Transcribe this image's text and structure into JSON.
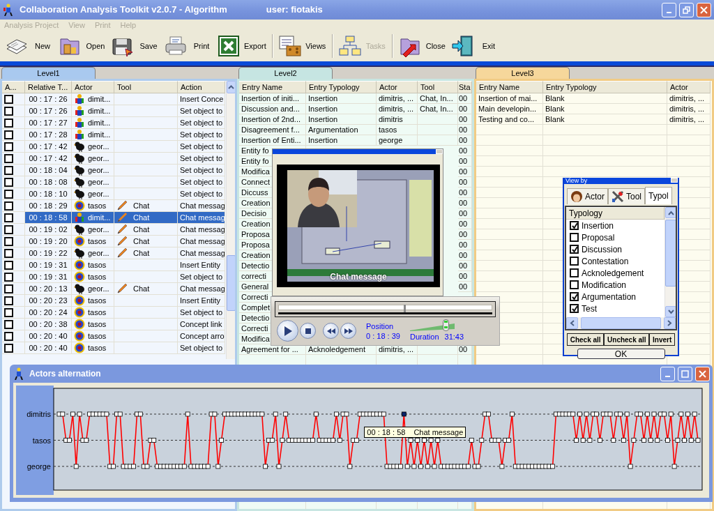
{
  "window": {
    "title": "Collaboration Analysis Toolkit v2.0.7 - Algorithm",
    "user": "user: fiotakis"
  },
  "menu": [
    {
      "label": "Analysis Project",
      "disabled": true
    },
    {
      "label": "View",
      "disabled": true
    },
    {
      "label": "Print",
      "disabled": true
    },
    {
      "label": "Help",
      "disabled": true
    }
  ],
  "toolbar": [
    {
      "label": "New",
      "kind": "new",
      "disabled": false
    },
    {
      "label": "Open",
      "kind": "open",
      "disabled": false
    },
    {
      "label": "Save",
      "kind": "save",
      "disabled": false
    },
    {
      "label": "Print",
      "kind": "print",
      "disabled": false
    },
    {
      "label": "Export",
      "kind": "export",
      "disabled": false
    },
    {
      "label": "Views",
      "kind": "views",
      "disabled": false,
      "separator_before": true
    },
    {
      "label": "Tasks",
      "kind": "tasks",
      "disabled": true,
      "separator_before": true
    },
    {
      "label": "Close",
      "kind": "close",
      "disabled": false,
      "separator_before": true
    },
    {
      "label": "Exit",
      "kind": "exit",
      "disabled": false
    }
  ],
  "panels": [
    {
      "tab": "Level1",
      "kind": "events",
      "columns": [
        "A...",
        "Relative T...",
        "Actor",
        "Tool",
        "Action"
      ],
      "rows": [
        {
          "checked": false,
          "selected": false,
          "time": "00 : 17 : 26",
          "actor": "dimit...",
          "kind": "figure",
          "action": "Insert Conce"
        },
        {
          "checked": false,
          "selected": false,
          "time": "00 : 17 : 26",
          "actor": "dimit...",
          "kind": "figure",
          "action": "Set object to"
        },
        {
          "checked": false,
          "selected": false,
          "time": "00 : 17 : 27",
          "actor": "dimit...",
          "kind": "figure",
          "action": "Set object to"
        },
        {
          "checked": false,
          "selected": false,
          "time": "00 : 17 : 28",
          "actor": "dimit...",
          "kind": "figure",
          "action": "Set object to"
        },
        {
          "checked": false,
          "selected": false,
          "time": "00 : 17 : 42",
          "actor": "geor...",
          "kind": "bird",
          "action": "Set object to"
        },
        {
          "checked": false,
          "selected": false,
          "time": "00 : 17 : 42",
          "actor": "geor...",
          "kind": "bird",
          "action": "Set object to"
        },
        {
          "checked": false,
          "selected": false,
          "time": "00 : 18 : 04",
          "actor": "geor...",
          "kind": "bird",
          "action": "Set object to"
        },
        {
          "checked": false,
          "selected": false,
          "time": "00 : 18 : 08",
          "actor": "geor...",
          "kind": "bird",
          "action": "Set object to"
        },
        {
          "checked": false,
          "selected": false,
          "time": "00 : 18 : 10",
          "actor": "geor...",
          "kind": "bird",
          "action": "Set object to"
        },
        {
          "checked": false,
          "selected": false,
          "time": "00 : 18 : 29",
          "actor": "tasos",
          "kind": "globe",
          "tool": "Chat",
          "action": "Chat messag"
        },
        {
          "checked": false,
          "selected": true,
          "time": "00 : 18 : 58",
          "actor": "dimit...",
          "kind": "figure",
          "tool": "Chat",
          "action": "Chat messag"
        },
        {
          "checked": false,
          "selected": false,
          "time": "00 : 19 : 02",
          "actor": "geor...",
          "kind": "bird",
          "tool": "Chat",
          "action": "Chat messag"
        },
        {
          "checked": false,
          "selected": false,
          "time": "00 : 19 : 20",
          "actor": "tasos",
          "kind": "globe",
          "tool": "Chat",
          "action": "Chat messag"
        },
        {
          "checked": false,
          "selected": false,
          "time": "00 : 19 : 22",
          "actor": "geor...",
          "kind": "bird",
          "tool": "Chat",
          "action": "Chat messag"
        },
        {
          "checked": false,
          "selected": false,
          "time": "00 : 19 : 31",
          "actor": "tasos",
          "kind": "globe",
          "action": "Insert Entity"
        },
        {
          "checked": false,
          "selected": false,
          "time": "00 : 19 : 31",
          "actor": "tasos",
          "kind": "globe",
          "action": "Set object to"
        },
        {
          "checked": false,
          "selected": false,
          "time": "00 : 20 : 13",
          "actor": "geor...",
          "kind": "bird",
          "tool": "Chat",
          "action": "Chat messag"
        },
        {
          "checked": false,
          "selected": false,
          "time": "00 : 20 : 23",
          "actor": "tasos",
          "kind": "globe",
          "action": "Insert Entity"
        },
        {
          "checked": false,
          "selected": false,
          "time": "00 : 20 : 24",
          "actor": "tasos",
          "kind": "globe",
          "action": "Set object to"
        },
        {
          "checked": false,
          "selected": false,
          "time": "00 : 20 : 38",
          "actor": "tasos",
          "kind": "globe",
          "action": "Concept link"
        },
        {
          "checked": false,
          "selected": false,
          "time": "00 : 20 : 40",
          "actor": "tasos",
          "kind": "globe",
          "action": "Concept arro"
        },
        {
          "checked": false,
          "selected": false,
          "time": "00 : 20 : 40",
          "actor": "tasos",
          "kind": "globe",
          "action": "Set object to"
        }
      ]
    },
    {
      "tab": "Level2",
      "kind": "entries",
      "columns": [
        "Entry Name",
        "Entry Typology",
        "Actor",
        "Tool",
        "Sta"
      ],
      "rows": [
        {
          "cells": [
            "Insertion of initi...",
            "Insertion",
            "dimitris, ...",
            "Chat, In...",
            "00"
          ]
        },
        {
          "cells": [
            "Discussion and...",
            "Insertion",
            "dimitris, ...",
            "Chat, In...",
            "00"
          ]
        },
        {
          "cells": [
            "Insertion of 2nd...",
            "Insertion",
            "dimitris",
            null,
            "00"
          ]
        },
        {
          "cells": [
            "Disagreement f...",
            "Argumentation",
            "tasos",
            null,
            "00"
          ]
        },
        {
          "cells": [
            "Insertion of Enti...",
            "Insertion",
            "george",
            null,
            "00"
          ]
        },
        {
          "cells": [
            "Entity fo",
            null,
            null,
            null,
            "00"
          ]
        },
        {
          "cells": [
            "Entity fo",
            null,
            null,
            null,
            "00"
          ]
        },
        {
          "cells": [
            "Modifica",
            null,
            null,
            null,
            "00"
          ]
        },
        {
          "cells": [
            "Connect",
            null,
            null,
            null,
            "00"
          ]
        },
        {
          "cells": [
            "Diccuss",
            null,
            null,
            null,
            "00"
          ]
        },
        {
          "cells": [
            "Creation",
            null,
            null,
            null,
            "00"
          ]
        },
        {
          "cells": [
            "Decisio",
            null,
            null,
            null,
            "00"
          ]
        },
        {
          "cells": [
            "Creation",
            null,
            null,
            null,
            "00"
          ]
        },
        {
          "cells": [
            "Proposa",
            null,
            null,
            null,
            "00"
          ]
        },
        {
          "cells": [
            "Proposa",
            null,
            null,
            null,
            "00"
          ]
        },
        {
          "cells": [
            "Creation",
            null,
            null,
            null,
            "00"
          ]
        },
        {
          "cells": [
            "Detectio",
            null,
            null,
            null,
            "00"
          ]
        },
        {
          "cells": [
            "correcti",
            null,
            null,
            null,
            "00"
          ]
        },
        {
          "cells": [
            "General",
            null,
            null,
            null,
            "00"
          ]
        },
        {
          "cells": [
            "Correcti",
            null,
            null,
            null,
            null
          ]
        },
        {
          "cells": [
            "Complet",
            null,
            null,
            null,
            null
          ]
        },
        {
          "cells": [
            "Detectio",
            null,
            null,
            null,
            null
          ]
        },
        {
          "cells": [
            "Correcti",
            null,
            null,
            null,
            null
          ]
        },
        {
          "cells": [
            "Modifica",
            null,
            null,
            null,
            null
          ]
        },
        {
          "cells": [
            "Agreement for ...",
            "Acknoledgement",
            "dimitris, ...",
            null,
            "00"
          ]
        }
      ]
    },
    {
      "tab": "Level3",
      "kind": "entries",
      "columns": [
        "Entry Name",
        "Entry Typology",
        "Actor"
      ],
      "rows": [
        {
          "cells": [
            "Insertion of mai...",
            "Blank",
            "dimitris, ..."
          ]
        },
        {
          "cells": [
            "Main developin...",
            "Blank",
            "dimitris, ..."
          ]
        },
        {
          "cells": [
            "Testing and co...",
            "Blank",
            "dimitris, ..."
          ]
        }
      ]
    }
  ],
  "video": {
    "caption": "Chat message",
    "seek": {
      "level": 0.59
    },
    "position_label": "Position",
    "position": "0 : 18 : 39",
    "volume": {
      "level": 0.8
    },
    "duration_label": "Duration",
    "duration": "31:43"
  },
  "view_by": {
    "title": "View by",
    "tabs": [
      {
        "label": "Actor",
        "kind": "actor",
        "selected": false
      },
      {
        "label": "Tool",
        "kind": "tool",
        "selected": false
      },
      {
        "label": "Typol",
        "selected": true
      }
    ],
    "list_header": "Typology",
    "items": [
      {
        "label": "Insertion",
        "checked": true
      },
      {
        "label": "Proposal",
        "checked": false
      },
      {
        "label": "Discussion",
        "checked": true
      },
      {
        "label": "Contestation",
        "checked": false
      },
      {
        "label": "Acknoledgement",
        "checked": false
      },
      {
        "label": "Modification",
        "checked": false
      },
      {
        "label": "Argumentation",
        "checked": true
      },
      {
        "label": "Test",
        "checked": true
      }
    ],
    "buttons": [
      "Check all",
      "Uncheck all",
      "Invert"
    ],
    "ok": "OK"
  },
  "actors_window": {
    "title": "Actors alternation",
    "lanes": [
      "dimitris",
      "tasos",
      "george"
    ],
    "tooltip": {
      "time": "00 : 18 : 58",
      "text": "Chat message"
    }
  }
}
